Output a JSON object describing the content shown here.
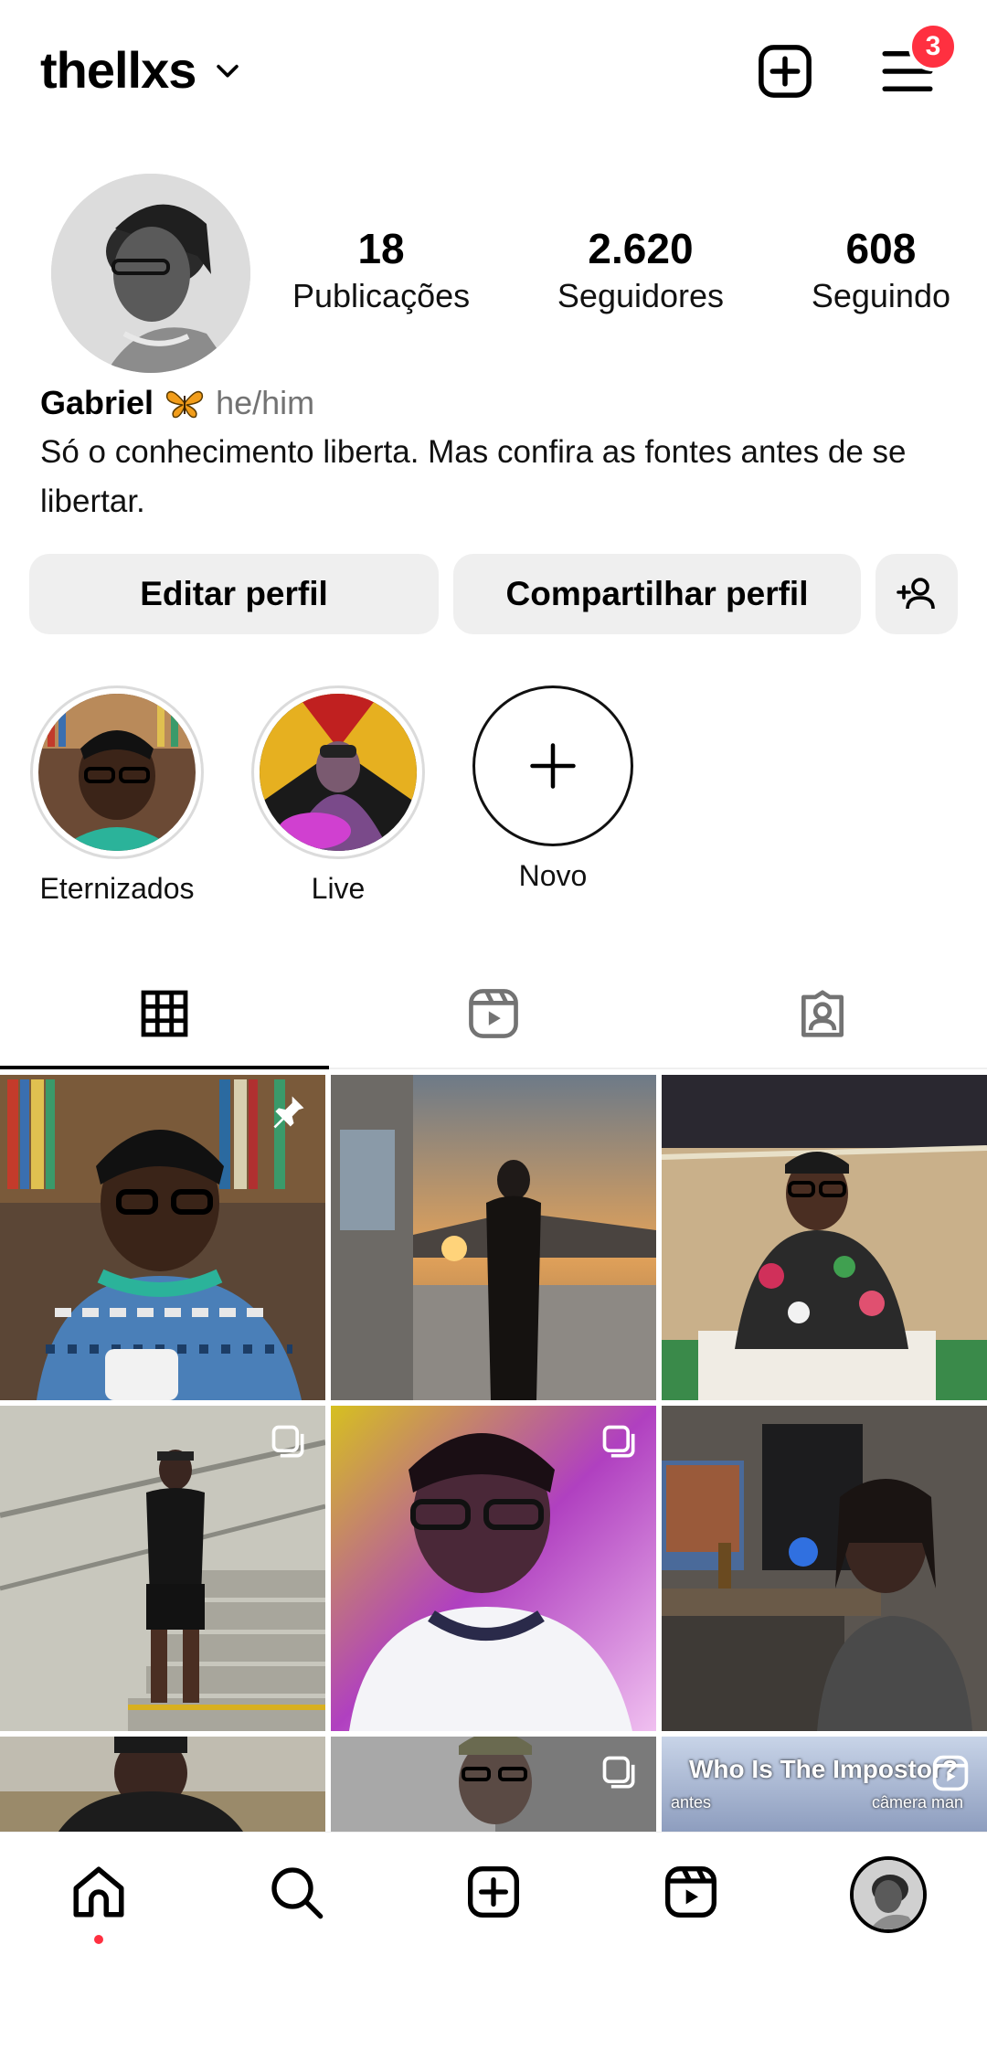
{
  "header": {
    "username": "thellxs",
    "notification_count": "3",
    "icons": [
      "chevron-down-icon",
      "new-post-icon",
      "menu-icon"
    ]
  },
  "profile": {
    "stats": [
      {
        "value": "18",
        "label": "Publicações"
      },
      {
        "value": "2.620",
        "label": "Seguidores"
      },
      {
        "value": "608",
        "label": "Seguindo"
      }
    ],
    "name": "Gabriel",
    "pronouns": "he/him",
    "bio": "Só o conhecimento liberta. Mas confira as fontes antes de se libertar."
  },
  "actions": {
    "edit_label": "Editar perfil",
    "share_label": "Compartilhar perfil"
  },
  "highlights": [
    {
      "label": "Eternizados"
    },
    {
      "label": "Live"
    },
    {
      "label": "Novo"
    }
  ],
  "tabs": [
    "grid-icon",
    "reels-icon",
    "tagged-icon"
  ],
  "grid": {
    "cell9_caption": "Who Is The Impostor?",
    "cell9_sub_left": "antes",
    "cell9_sub_right": "câmera man"
  },
  "bottom_nav": [
    "home-icon",
    "search-icon",
    "create-icon",
    "reels-icon",
    "profile-avatar"
  ],
  "colors": {
    "badge": "#ff3040",
    "button_bg": "#efefef",
    "secondary_text": "#737373"
  }
}
